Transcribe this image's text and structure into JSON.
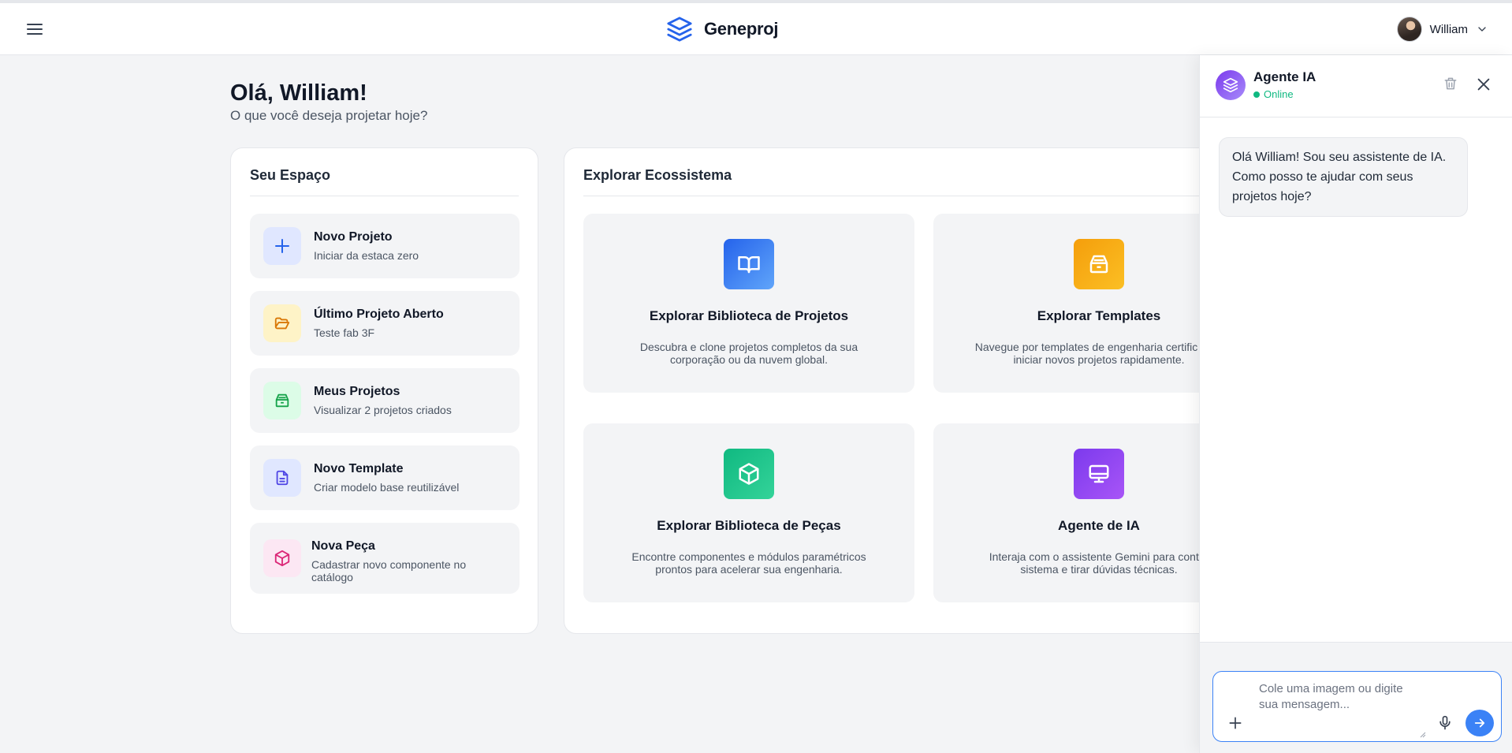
{
  "header": {
    "brand_name": "Geneproj",
    "menu_icon": "hamburger-icon",
    "logo_icon": "stack-layers-icon",
    "user_name": "William",
    "brand_color": "#2563eb"
  },
  "greeting": {
    "title": "Olá, William!",
    "subtitle": "O que você deseja projetar hoje?"
  },
  "space": {
    "title": "Seu Espaço",
    "items": [
      {
        "title": "Novo Projeto",
        "subtitle": "Iniciar da estaca zero",
        "icon": "plus-icon",
        "color": "#2563eb"
      },
      {
        "title": "Último Projeto Aberto",
        "subtitle": "Teste fab 3F",
        "icon": "folder-open-icon",
        "color": "#d97706"
      },
      {
        "title": "Meus Projetos",
        "subtitle": "Visualizar 2 projetos criados",
        "icon": "archive-icon",
        "color": "#16a34a"
      },
      {
        "title": "Novo Template",
        "subtitle": "Criar modelo base reutilizável",
        "icon": "document-icon",
        "color": "#4f46e5"
      },
      {
        "title": "Nova Peça",
        "subtitle": "Cadastrar novo componente no catálogo",
        "icon": "cube-icon",
        "color": "#db2777"
      }
    ]
  },
  "ecosystem": {
    "title": "Explorar Ecossistema",
    "cards": [
      {
        "title": "Explorar Biblioteca de Projetos",
        "description": "Descubra e clone projetos completos da sua corporação ou da nuvem global.",
        "icon": "open-book-icon",
        "color": "#3b82f6"
      },
      {
        "title": "Explorar Templates",
        "description": "Navegue por templates de engenharia certific para iniciar novos projetos rapidamente.",
        "icon": "archive-icon",
        "color": "#f59e0b"
      },
      {
        "title": "Explorar Biblioteca de Peças",
        "description": "Encontre componentes e módulos paramétricos prontos para acelerar sua engenharia.",
        "icon": "cube-icon",
        "color": "#10b981"
      },
      {
        "title": "Agente de IA",
        "description": "Interaja com o assistente Gemini para contro sistema e tirar dúvidas técnicas.",
        "icon": "monitor-icon",
        "color": "#8b5cf6"
      }
    ]
  },
  "ai_panel": {
    "name": "Agente IA",
    "status": "Online",
    "status_color": "#10b981",
    "message": "Olá William! Sou seu assistente de IA. Como posso te ajudar com seus projetos hoje?",
    "input_placeholder": "Cole uma imagem ou digite sua mensagem...",
    "input_value": ""
  }
}
